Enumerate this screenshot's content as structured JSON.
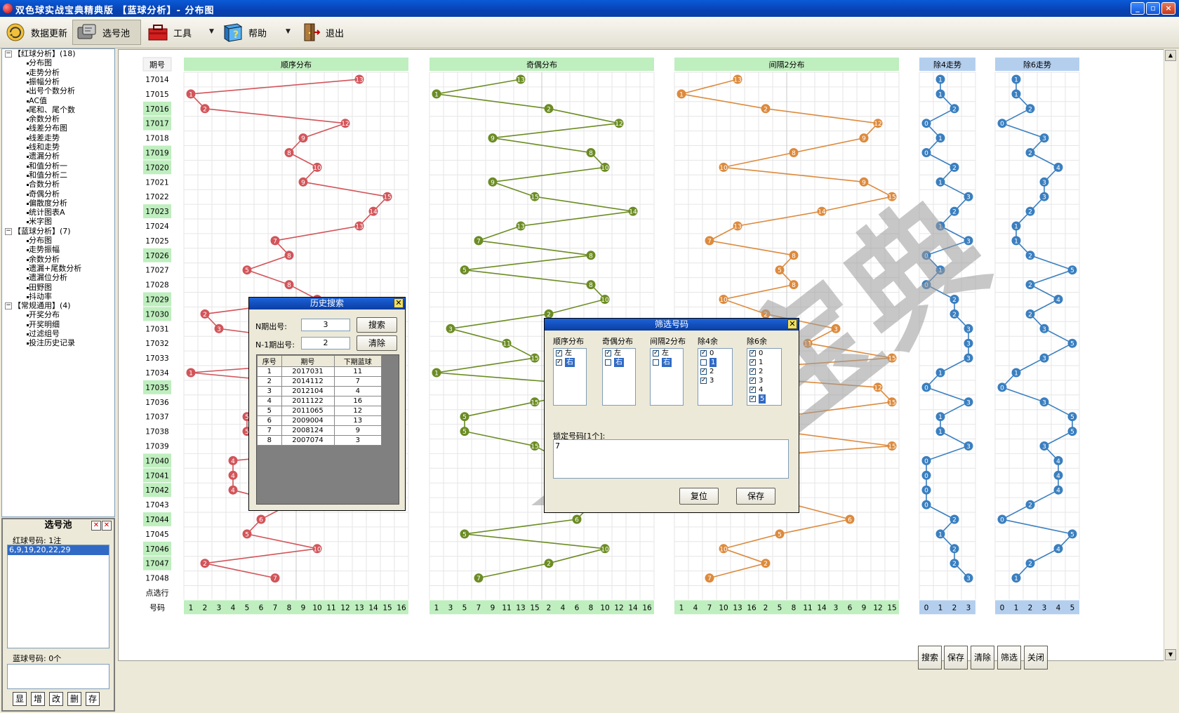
{
  "window": {
    "title": "双色球实战宝典精典版 【蓝球分析】- 分布图",
    "btn_min": "_",
    "btn_max": "▫",
    "btn_close": "×"
  },
  "toolbar": {
    "items": [
      {
        "label": "数据更新",
        "icon": "data-update-icon"
      },
      {
        "label": "选号池",
        "icon": "number-pool-icon"
      },
      {
        "label": "工具",
        "icon": "toolbox-icon"
      },
      {
        "label": "帮助",
        "icon": "help-book-icon"
      },
      {
        "label": "退出",
        "icon": "exit-door-icon"
      }
    ]
  },
  "tree": {
    "groups": [
      {
        "label": "【红球分析】(18)",
        "items": [
          "分布图",
          "走势分析",
          "振幅分析",
          "出号个数分析",
          "AC值",
          "尾和、尾个数",
          "余数分析",
          "线差分布图",
          "线差走势",
          "线和走势",
          "遗漏分析",
          "和值分析一",
          "和值分析二",
          "合数分析",
          "奇偶分析",
          "偏散度分析",
          "统计图表A",
          "米字图"
        ]
      },
      {
        "label": "【蓝球分析】(7)",
        "items": [
          "分布图",
          "走势振幅",
          "余数分析",
          "遗漏+尾数分析",
          "遗漏位分析",
          "田野图",
          "抖动率"
        ]
      },
      {
        "label": "【常规通用】(4)",
        "items": [
          "开奖分布",
          "开奖明细",
          "过滤组号",
          "投注历史记录"
        ]
      }
    ]
  },
  "pool": {
    "title": "选号池",
    "red_label": "红球号码: 1注",
    "red_items": [
      "6,9,19,20,22,29"
    ],
    "blue_label": "蓝球号码: 0个",
    "buttons": [
      "显",
      "增",
      "改",
      "删",
      "存"
    ]
  },
  "chart_data": {
    "type": "line",
    "issue_header": "期号",
    "issues": [
      "17014",
      "17015",
      "17016",
      "17017",
      "17018",
      "17019",
      "17020",
      "17021",
      "17022",
      "17023",
      "17024",
      "17025",
      "17026",
      "17027",
      "17028",
      "17029",
      "17030",
      "17031",
      "17032",
      "17033",
      "17034",
      "17035",
      "17036",
      "17037",
      "17038",
      "17039",
      "17040",
      "17041",
      "17042",
      "17043",
      "17044",
      "17045",
      "17046",
      "17047",
      "17048"
    ],
    "highlight_issues": [
      "17016",
      "17017",
      "17019",
      "17020",
      "17023",
      "17026",
      "17029",
      "17030",
      "17035",
      "17040",
      "17041",
      "17042",
      "17044",
      "17046",
      "17047"
    ],
    "footer_row1": "点选行",
    "footer_row2": "号码",
    "values": [
      13,
      1,
      2,
      12,
      9,
      8,
      10,
      9,
      15,
      14,
      13,
      7,
      8,
      5,
      8,
      10,
      2,
      3,
      11,
      15,
      1,
      12,
      15,
      5,
      5,
      15,
      4,
      4,
      4,
      8,
      6,
      5,
      10,
      2,
      7
    ],
    "panels": [
      {
        "title": "顺序分布",
        "order": [
          1,
          2,
          3,
          4,
          5,
          6,
          7,
          8,
          9,
          10,
          11,
          12,
          13,
          14,
          15,
          16
        ],
        "color": "#d2555a",
        "header_bg": "#bfeebf"
      },
      {
        "title": "奇偶分布",
        "order": [
          1,
          3,
          5,
          7,
          9,
          11,
          13,
          15,
          2,
          4,
          6,
          8,
          10,
          12,
          14,
          16
        ],
        "color": "#6b8c23",
        "header_bg": "#bfeebf"
      },
      {
        "title": "间隔2分布",
        "order": [
          1,
          4,
          7,
          10,
          13,
          16,
          2,
          5,
          8,
          11,
          14,
          3,
          6,
          9,
          12,
          15
        ],
        "color": "#dd8a3c",
        "header_bg": "#bfeebf"
      },
      {
        "title": "除4走势",
        "mod": 4,
        "color": "#3a7fc0",
        "header_bg": "#b4cfee"
      },
      {
        "title": "除6走势",
        "mod": 6,
        "color": "#3a7fc0",
        "header_bg": "#b4cfee"
      }
    ],
    "watermark": "实战宝典"
  },
  "history_dialog": {
    "title": "历史搜索",
    "n_label": "N期出号:",
    "n_value": "3",
    "n1_label": "N-1期出号:",
    "n1_value": "2",
    "search": "搜索",
    "clear": "清除",
    "columns": [
      "序号",
      "期号",
      "下期蓝球"
    ],
    "rows": [
      [
        "1",
        "2017031",
        "11"
      ],
      [
        "2",
        "2014112",
        "7"
      ],
      [
        "3",
        "2012104",
        "4"
      ],
      [
        "4",
        "2011122",
        "16"
      ],
      [
        "5",
        "2011065",
        "12"
      ],
      [
        "6",
        "2009004",
        "13"
      ],
      [
        "7",
        "2008124",
        "9"
      ],
      [
        "8",
        "2007074",
        "3"
      ]
    ]
  },
  "filter_dialog": {
    "title": "筛选号码",
    "groups": [
      {
        "title": "顺序分布",
        "items": [
          {
            "label": "左",
            "checked": true,
            "sel": false
          },
          {
            "label": "右",
            "checked": true,
            "sel": true
          }
        ]
      },
      {
        "title": "奇偶分布",
        "items": [
          {
            "label": "左",
            "checked": true,
            "sel": false
          },
          {
            "label": "右",
            "checked": false,
            "sel": true
          }
        ]
      },
      {
        "title": "间隔2分布",
        "items": [
          {
            "label": "左",
            "checked": true,
            "sel": false
          },
          {
            "label": "右",
            "checked": false,
            "sel": true
          }
        ]
      },
      {
        "title": "除4余",
        "items": [
          {
            "label": "0",
            "checked": true,
            "sel": false
          },
          {
            "label": "1",
            "checked": false,
            "sel": true
          },
          {
            "label": "2",
            "checked": true,
            "sel": false
          },
          {
            "label": "3",
            "checked": true,
            "sel": false
          }
        ]
      },
      {
        "title": "除6余",
        "items": [
          {
            "label": "0",
            "checked": true,
            "sel": false
          },
          {
            "label": "1",
            "checked": true,
            "sel": false
          },
          {
            "label": "2",
            "checked": true,
            "sel": false
          },
          {
            "label": "3",
            "checked": true,
            "sel": false
          },
          {
            "label": "4",
            "checked": true,
            "sel": false
          },
          {
            "label": "5",
            "checked": true,
            "sel": true
          }
        ]
      }
    ],
    "lock_label": "锁定号码[1个]:",
    "lock_value": "7",
    "reset": "复位",
    "save": "保存"
  },
  "bottom_buttons": [
    "搜索",
    "保存",
    "清除",
    "筛选",
    "关闭"
  ]
}
